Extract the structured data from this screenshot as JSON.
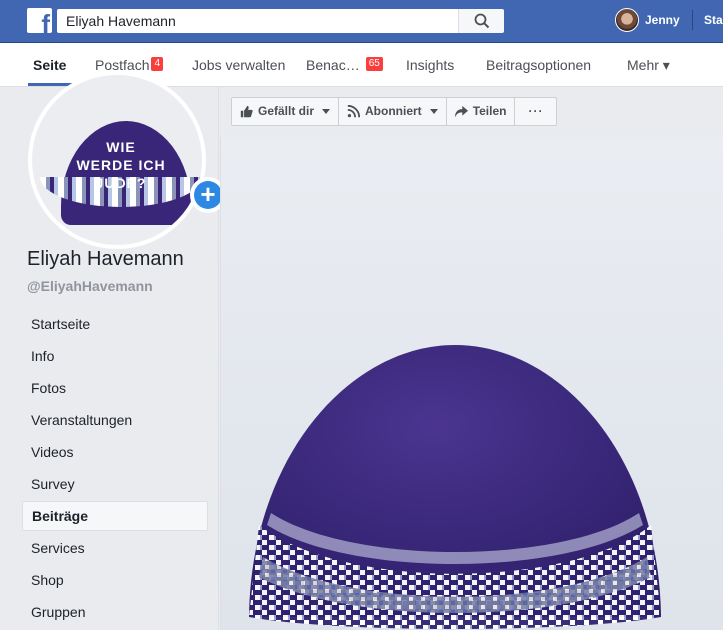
{
  "topbar": {
    "search_value": "Eliyah Havemann",
    "user_name": "Jenny",
    "start_label": "Sta"
  },
  "tabs": [
    {
      "label": "Seite",
      "active": true
    },
    {
      "label": "Postfach",
      "badge": "4"
    },
    {
      "label": "Jobs verwalten"
    },
    {
      "label": "Benac…",
      "badge": "65"
    },
    {
      "label": "Insights"
    },
    {
      "label": "Beitragsoptionen"
    },
    {
      "label": "Mehr ▾"
    }
  ],
  "profile": {
    "kippah_text_line1": "WIE",
    "kippah_text_line2": "WERDE ICH",
    "kippah_text_line3": "JUDE?",
    "name": "Eliyah Havemann",
    "handle": "@EliyahHavemann"
  },
  "menu": [
    "Startseite",
    "Info",
    "Fotos",
    "Veranstaltungen",
    "Videos",
    "Survey",
    "Beiträge",
    "Services",
    "Shop",
    "Gruppen"
  ],
  "menu_selected": "Beiträge",
  "actions": {
    "like_label": "Gefällt dir",
    "follow_label": "Abonniert",
    "share_label": "Teilen",
    "more_label": "···"
  },
  "colors": {
    "brand": "#4267b2",
    "badge": "#fa3e3e",
    "kippah": "#3a2678"
  }
}
